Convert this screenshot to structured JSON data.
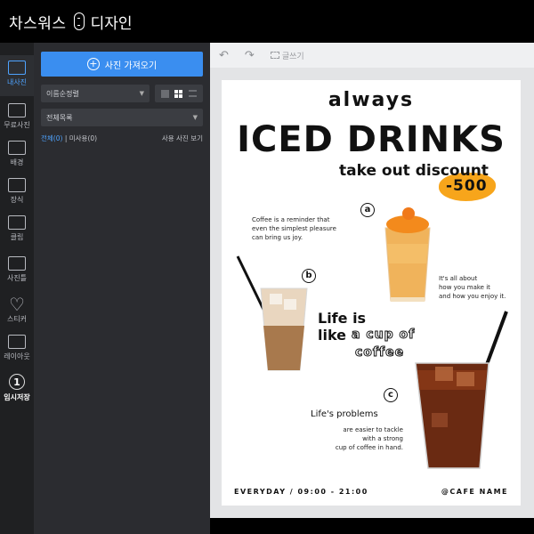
{
  "app": {
    "title": "차스워스",
    "title_suffix": "디자인"
  },
  "panel": {
    "import_button": "사진 가져오기",
    "sort_select": "이름순정렬",
    "folder_select": "전체목록",
    "filter_all": "전체(0)",
    "filter_unused": "미사용(0)",
    "hide_used": "사용 사진 보기"
  },
  "rail": {
    "items": [
      {
        "label": "내사진",
        "icon": "photo-icon"
      },
      {
        "label": "무료사진",
        "icon": "free-photo-icon"
      },
      {
        "label": "배경",
        "icon": "background-icon"
      },
      {
        "label": "장식",
        "icon": "decoration-icon"
      },
      {
        "label": "클립",
        "icon": "clip-icon"
      },
      {
        "label": "사진틀",
        "icon": "frame-icon"
      },
      {
        "label": "스티커",
        "icon": "heart-icon"
      },
      {
        "label": "레이아웃",
        "icon": "layout-icon"
      },
      {
        "label": "임시저장",
        "icon": "save-icon"
      }
    ],
    "save_number": "1"
  },
  "toolbar": {
    "text_tool": "글쓰기"
  },
  "poster": {
    "always": "always",
    "headline": "ICED DRINKS",
    "discount": "take out discount",
    "discount_value": "-500",
    "marker_a": "a",
    "marker_b": "b",
    "marker_c": "c",
    "coffee_reminder": [
      "Coffee is a reminder that",
      "even the simplest pleasure",
      "can bring us joy."
    ],
    "its_about": [
      "It's all about",
      "how you make it",
      "and how you enjoy it."
    ],
    "life_line1": "Life is",
    "life_line2": "like",
    "cup_of": "a cup of",
    "coffee_word": "coffee",
    "problems_title": "Life's problems",
    "problems_body": [
      "are easier to tackle",
      "with a strong",
      "cup of coffee in hand."
    ],
    "hours": "EVERYDAY / 09:00 - 21:00",
    "cafe_name": "@CAFE NAME",
    "accent_color": "#f7a51b"
  }
}
